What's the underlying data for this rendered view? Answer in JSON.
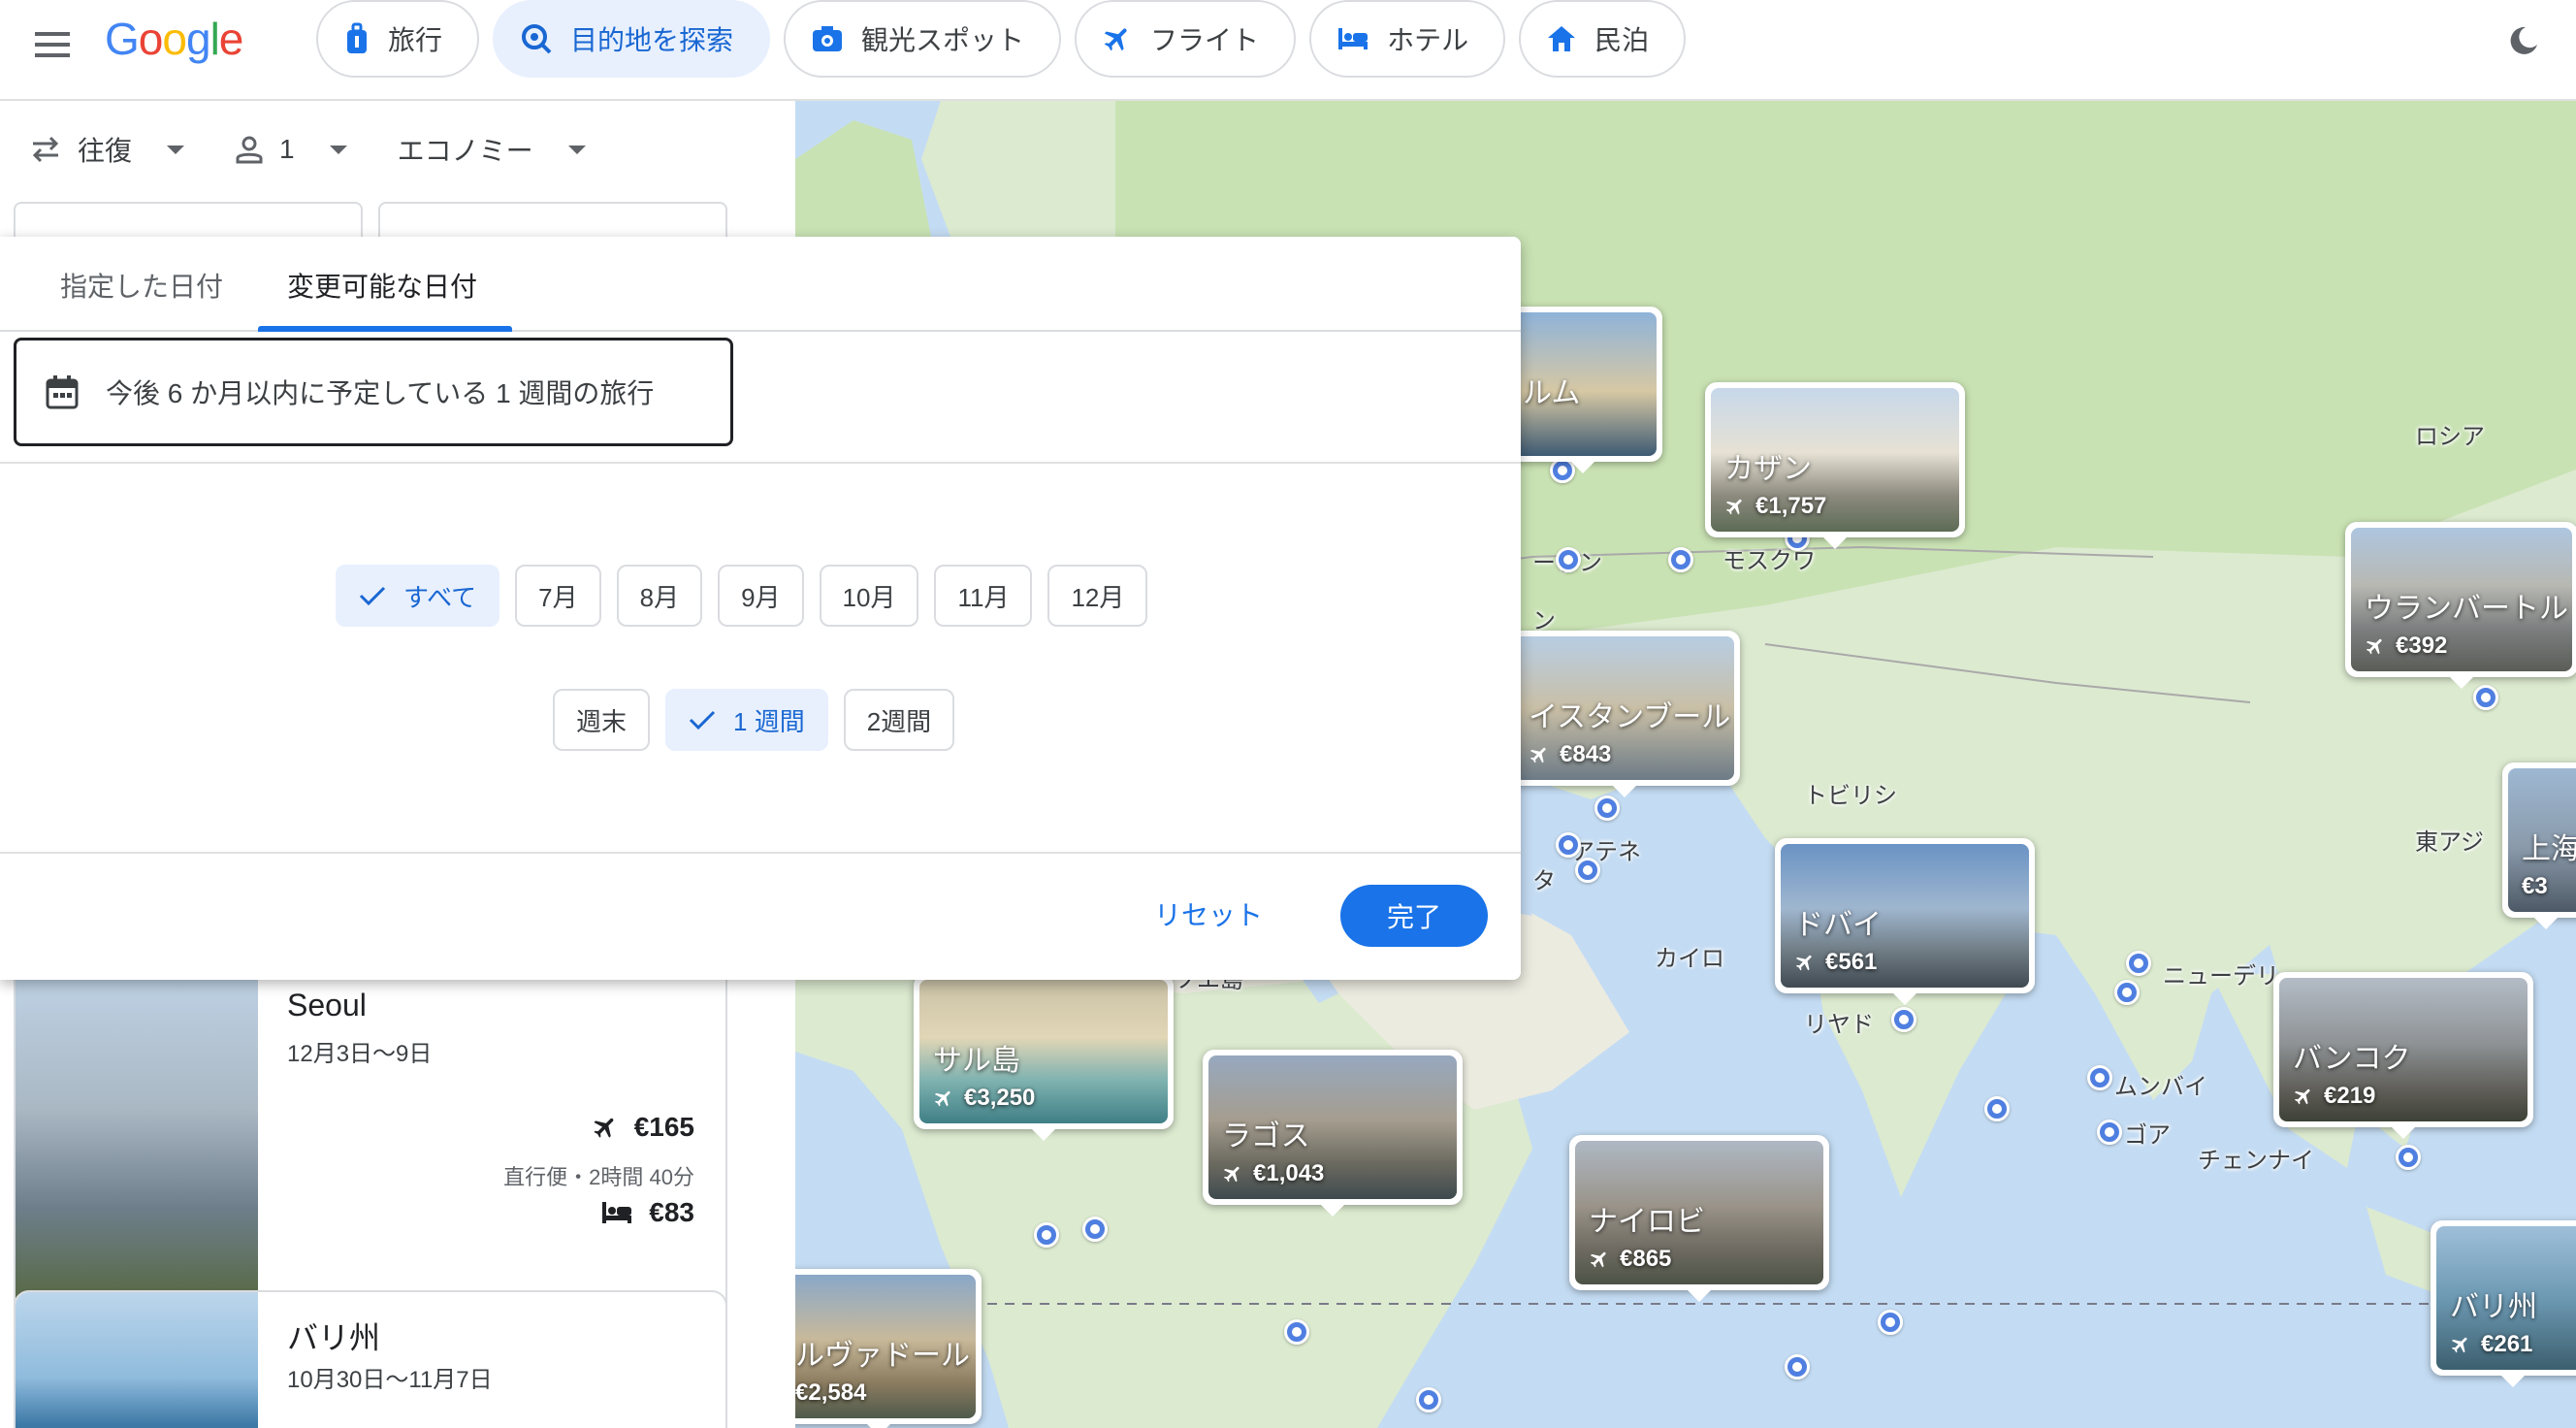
{
  "header": {
    "logo_text": "Google",
    "nav": [
      {
        "label": "旅行",
        "icon": "luggage-icon"
      },
      {
        "label": "目的地を探索",
        "icon": "explore-icon",
        "active": true
      },
      {
        "label": "観光スポット",
        "icon": "camera-icon"
      },
      {
        "label": "フライト",
        "icon": "airplane-icon"
      },
      {
        "label": "ホテル",
        "icon": "bed-icon"
      },
      {
        "label": "民泊",
        "icon": "home-icon"
      }
    ],
    "theme_icon": "dark-mode-icon"
  },
  "trip_options": {
    "trip_type": "往復",
    "passengers": "1",
    "cabin_class": "エコノミー"
  },
  "date_dialog": {
    "tabs": [
      {
        "label": "指定した日付"
      },
      {
        "label": "変更可能な日付",
        "active": true
      }
    ],
    "flexible_text": "今後 6 か月以内に予定している 1 週間の旅行",
    "months": [
      {
        "label": "すべて",
        "selected": true
      },
      {
        "label": "7月"
      },
      {
        "label": "8月"
      },
      {
        "label": "9月"
      },
      {
        "label": "10月"
      },
      {
        "label": "11月"
      },
      {
        "label": "12月"
      }
    ],
    "durations": [
      {
        "label": "週末"
      },
      {
        "label": "1 週間",
        "selected": true
      },
      {
        "label": "2週間"
      }
    ],
    "reset_label": "リセット",
    "done_label": "完了"
  },
  "results": [
    {
      "title": "Seoul",
      "dates": "12月3日〜9日",
      "flight_price": "€165",
      "flight_info": "直行便・2時間 40分",
      "hotel_price": "€83"
    },
    {
      "title": "バリ州",
      "dates": "10月30日〜11月7日"
    }
  ],
  "map": {
    "labels": [
      "ロシア",
      "モスクワ",
      "ーゲン",
      "ン",
      "トビリシ",
      "アテネ",
      "タ",
      "カイロ",
      "リヤド",
      "ニューデリ",
      "ムンバイ",
      "ゴア",
      "チェンナイ",
      "東アジ",
      "ソエ島"
    ],
    "cards": [
      {
        "name": "ルム",
        "price": ""
      },
      {
        "name": "カザン",
        "price": "€1,757"
      },
      {
        "name": "ウランバートル",
        "price": "€392"
      },
      {
        "name": "イスタンブール",
        "price": "€843"
      },
      {
        "name": "上海",
        "price": "€3"
      },
      {
        "name": "ドバイ",
        "price": "€561"
      },
      {
        "name": "サル島",
        "price": "€3,250"
      },
      {
        "name": "バンコク",
        "price": "€219"
      },
      {
        "name": "ラゴス",
        "price": "€1,043"
      },
      {
        "name": "ナイロビ",
        "price": "€865"
      },
      {
        "name": "バリ州",
        "price": "€261"
      },
      {
        "name": "ルヴァドール",
        "price": "€2,584"
      }
    ]
  }
}
